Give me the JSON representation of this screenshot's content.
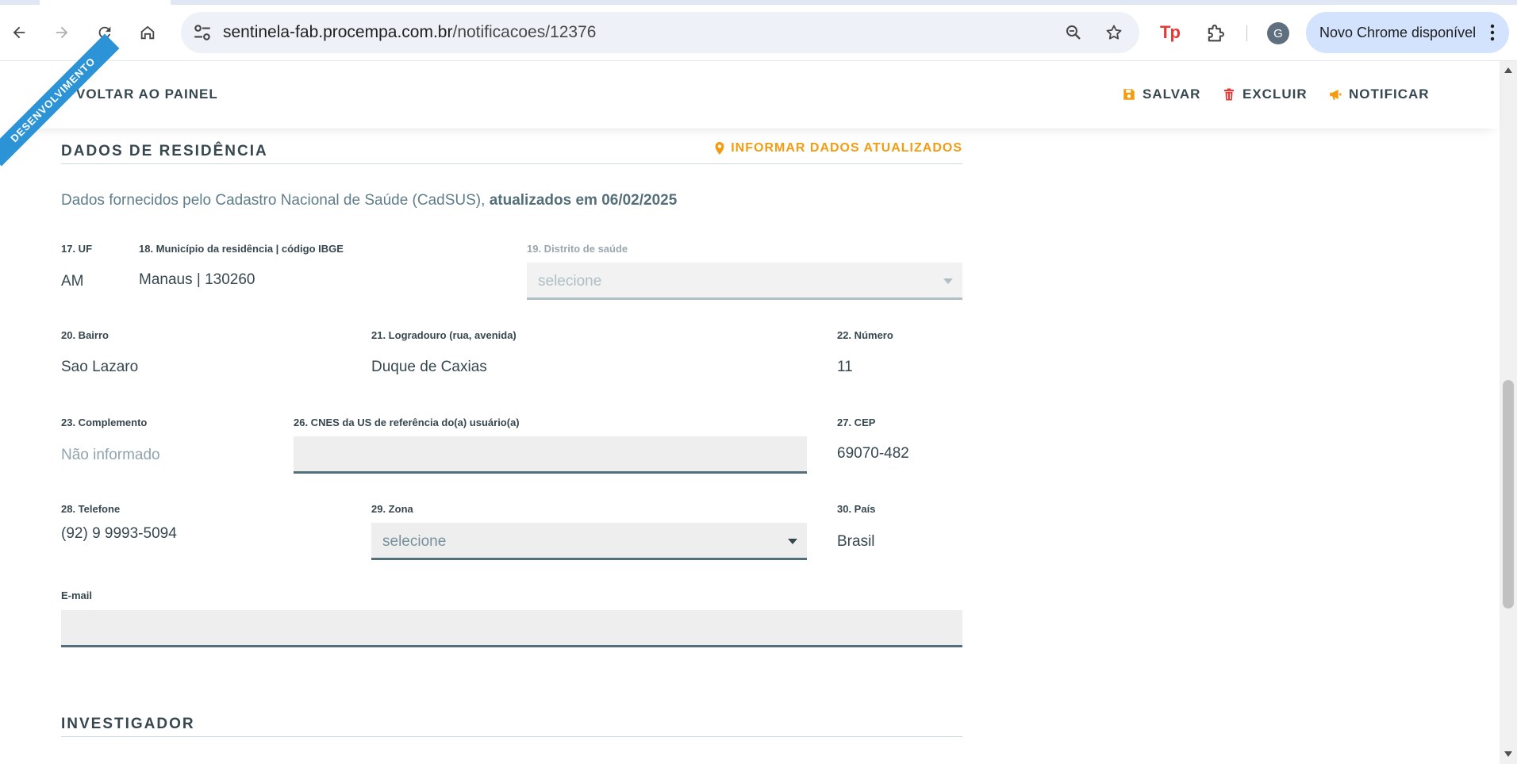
{
  "browser": {
    "url_host": "sentinela-fab.procempa.com.br",
    "url_path": "/notificacoes/12376",
    "avatar_letter": "G",
    "update_label": "Novo Chrome disponível",
    "extension_label": "Tp",
    "icons": [
      "back-arrow-icon",
      "forward-arrow-icon",
      "reload-icon",
      "home-icon",
      "site-info-icon",
      "zoom-icon",
      "bookmark-star-icon",
      "extensions-puzzle-icon",
      "kebab-menu-icon"
    ]
  },
  "header": {
    "ribbon": "DESENVOLVIMENTO",
    "back_label": "VOLTAR AO PAINEL",
    "save_label": "SALVAR",
    "delete_label": "EXCLUIR",
    "notify_label": "NOTIFICAR",
    "colors": {
      "accent": "#f39c12",
      "danger": "#e53935",
      "ribbon": "#2b93d6"
    }
  },
  "residence": {
    "title": "DADOS DE RESIDÊNCIA",
    "update_link": "INFORMAR DADOS ATUALIZADOS",
    "intro_text": "Dados fornecidos pelo Cadastro Nacional de Saúde (CadSUS),",
    "intro_bold": "atualizados em 06/02/2025",
    "fields": {
      "uf": {
        "label": "17. UF",
        "value": "AM"
      },
      "municipio": {
        "label": "18. Município da residência | código IBGE",
        "value": "Manaus | 130260"
      },
      "distrito": {
        "label": "19. Distrito de saúde",
        "value": "selecione"
      },
      "bairro": {
        "label": "20. Bairro",
        "value": "Sao Lazaro"
      },
      "logradouro": {
        "label": "21. Logradouro (rua, avenida)",
        "value": "Duque de Caxias"
      },
      "numero": {
        "label": "22. Número",
        "value": "11"
      },
      "complemento": {
        "label": "23. Complemento",
        "value": "Não informado"
      },
      "cnes": {
        "label": "26. CNES da US de referência do(a) usuário(a)",
        "value": ""
      },
      "cep": {
        "label": "27. CEP",
        "value": "69070-482"
      },
      "telefone": {
        "label": "28. Telefone",
        "value": "(92) 9 9993-5094"
      },
      "zona": {
        "label": "29. Zona",
        "value": "selecione"
      },
      "pais": {
        "label": "30. País",
        "value": "Brasil"
      },
      "email": {
        "label": "E-mail",
        "value": ""
      }
    }
  },
  "investigator": {
    "title": "INVESTIGADOR"
  }
}
